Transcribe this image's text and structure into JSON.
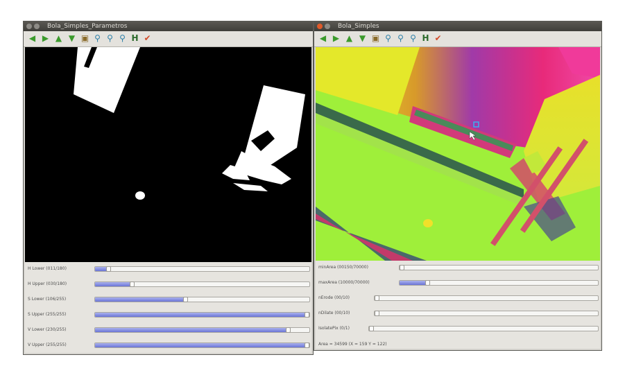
{
  "left_window": {
    "title": "Bola_Simples_Parametros",
    "trackbars": [
      {
        "label": "H Lower  (011/180)",
        "level": 0.06
      },
      {
        "label": "H Upper  (030/180)",
        "level": 0.17
      },
      {
        "label": "S Lower  (106/255)",
        "level": 0.42
      },
      {
        "label": "S Upper  (255/255)",
        "level": 1.0
      },
      {
        "label": "V Lower  (230/255)",
        "level": 0.9
      },
      {
        "label": "V Upper  (255/255)",
        "level": 1.0
      }
    ]
  },
  "right_window": {
    "title": "Bola_Simples",
    "trackbars": [
      {
        "label": "minArea  (00150/70000)",
        "level": 0.01
      },
      {
        "label": "maxArea  (10000/70000)",
        "level": 0.14
      },
      {
        "label": "nErode  (00/10)",
        "level": 0.0
      },
      {
        "label": "nDilate  (00/10)",
        "level": 0.0
      },
      {
        "label": "IsolatePix (0/1)",
        "level": 0.0
      }
    ],
    "status": "Area = 34599   (X = 159   Y = 122)"
  },
  "toolbar_icons": [
    "arrow-left-icon",
    "arrow-right-icon",
    "arrow-up-icon",
    "arrow-down-icon",
    "save-icon",
    "zoom-reset-icon",
    "zoom-in-icon",
    "zoom-out-icon",
    "save-image-icon",
    "properties-icon"
  ],
  "colors": {
    "titlebar": "#4a4945",
    "window_bg": "#d6d4cf",
    "slider_fill": "#7c86e0",
    "toolbar_icon": "#3b9a2c",
    "close_button": "#e05a2a"
  }
}
